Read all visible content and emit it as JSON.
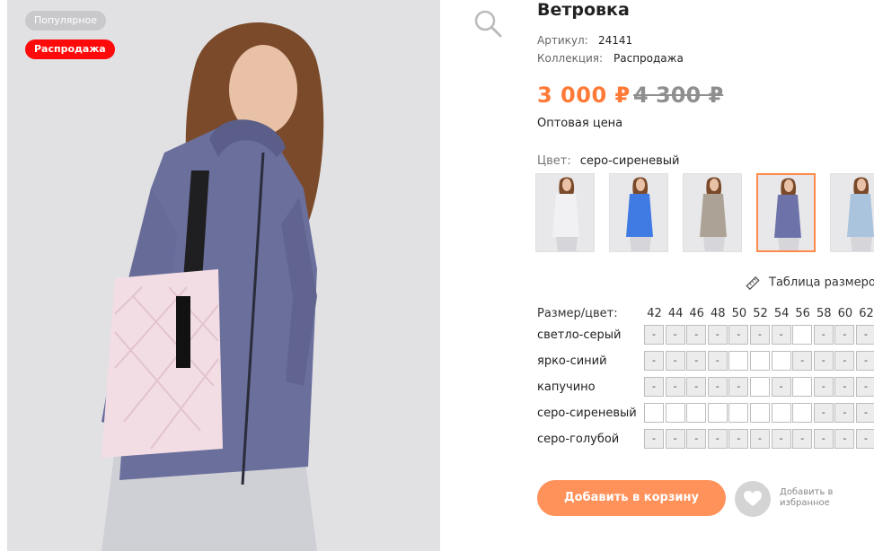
{
  "badges": {
    "popular": "Популярное",
    "sale": "Распродажа"
  },
  "product": {
    "title": "Ветровка",
    "sku_label": "Артикул:",
    "sku": "24141",
    "collection_label": "Коллекция:",
    "collection": "Распродажа",
    "price": "3 000 ₽",
    "old_price": "4 300 ₽",
    "price_note": "Оптовая цена",
    "color_label": "Цвет:",
    "color": "серо-сиреневый"
  },
  "colors": {
    "thumb_colors": [
      "#f1f1f3",
      "#3f7be3",
      "#aca295",
      "#6d73a8",
      "#aac4de"
    ],
    "selected_index": 3,
    "accent": "#ff8a4a"
  },
  "size_table_link": "Таблица размеров",
  "grid": {
    "header": "Размер/цвет:",
    "sizes": [
      "42",
      "44",
      "46",
      "48",
      "50",
      "52",
      "54",
      "56",
      "58",
      "60",
      "62"
    ],
    "rows": [
      {
        "label": "светло-серый",
        "cells": [
          "-",
          "-",
          "-",
          "-",
          "-",
          "-",
          "-",
          "",
          "-",
          "-",
          "-"
        ]
      },
      {
        "label": "ярко-синий",
        "cells": [
          "-",
          "-",
          "-",
          "-",
          "",
          "",
          "",
          "-",
          "-",
          "-",
          "-"
        ]
      },
      {
        "label": "капучино",
        "cells": [
          "-",
          "-",
          "-",
          "-",
          "-",
          "",
          "-",
          "",
          "-",
          "-",
          "-"
        ]
      },
      {
        "label": "серо-сиреневый",
        "cells": [
          "",
          "",
          "",
          "",
          "",
          "",
          "",
          "",
          "-",
          "-",
          "-"
        ]
      },
      {
        "label": "серо-голубой",
        "cells": [
          "-",
          "-",
          "-",
          "-",
          "-",
          "-",
          "-",
          "-",
          "-",
          "-",
          "-"
        ]
      }
    ]
  },
  "actions": {
    "add_to_cart": "Добавить в корзину",
    "favorite": "Добавить в избранное"
  },
  "theme": {
    "accent": "#ff7a36",
    "button": "#ff915a",
    "sale_badge": "#ff0a0a"
  }
}
